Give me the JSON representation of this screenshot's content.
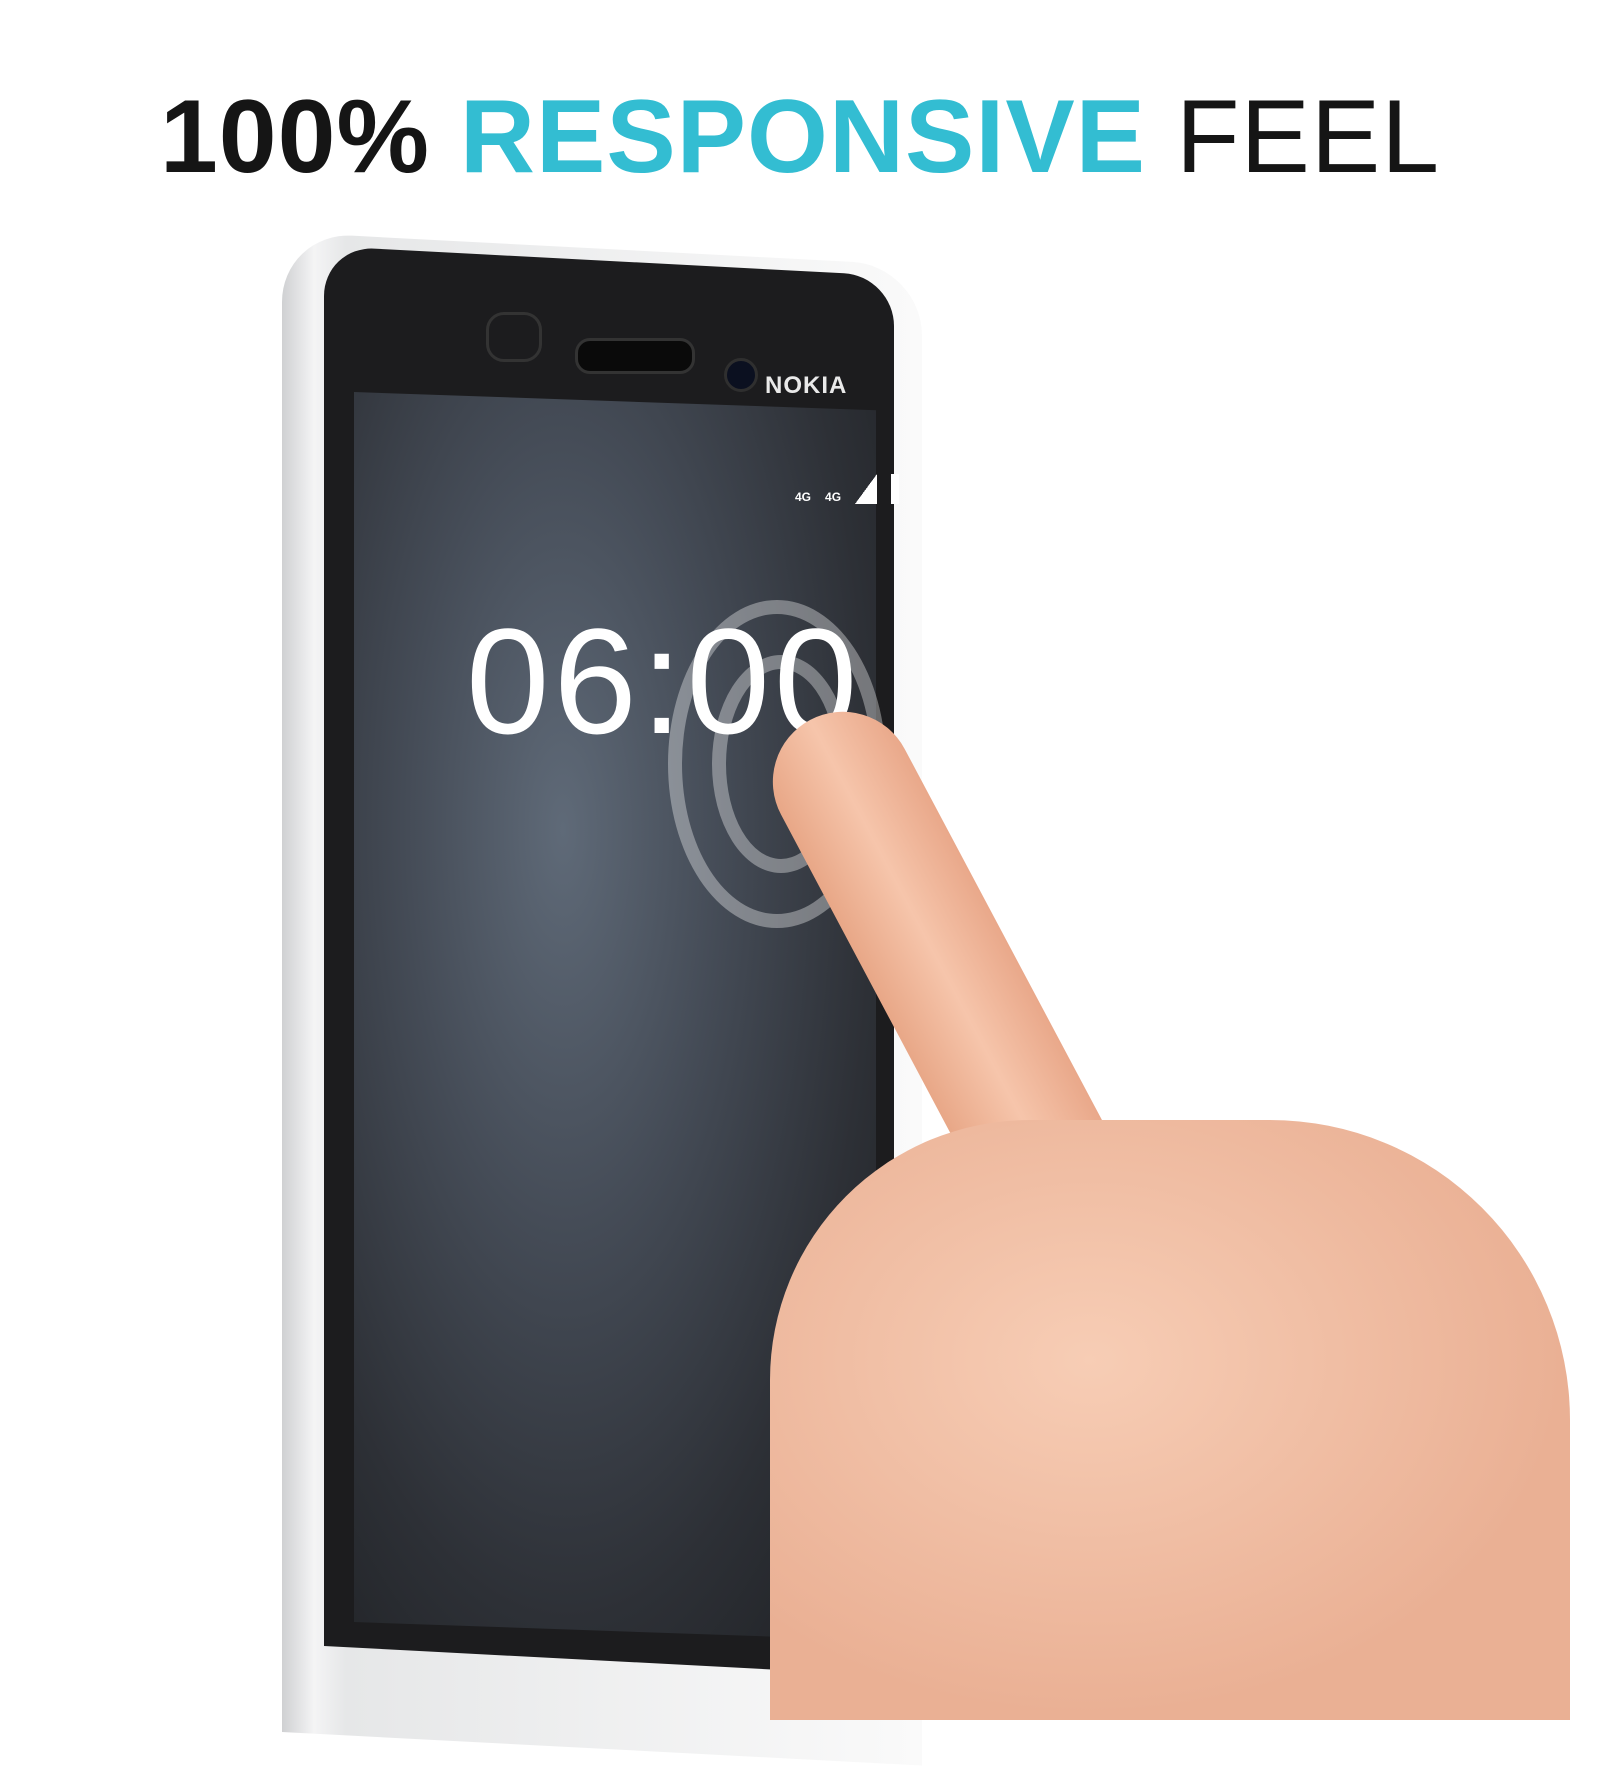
{
  "headline": {
    "part1": "100%",
    "part2": "RESPONSIVE",
    "part3": "FEEL"
  },
  "colors": {
    "accent": "#33bdd2",
    "dark": "#151515"
  },
  "phone": {
    "brand": "NOKIA",
    "status_bar": {
      "network1": "4G",
      "network2": "4G",
      "icons": [
        "data-arrows-icon",
        "signal-icon",
        "battery-icon"
      ]
    },
    "clock": "06:00"
  }
}
